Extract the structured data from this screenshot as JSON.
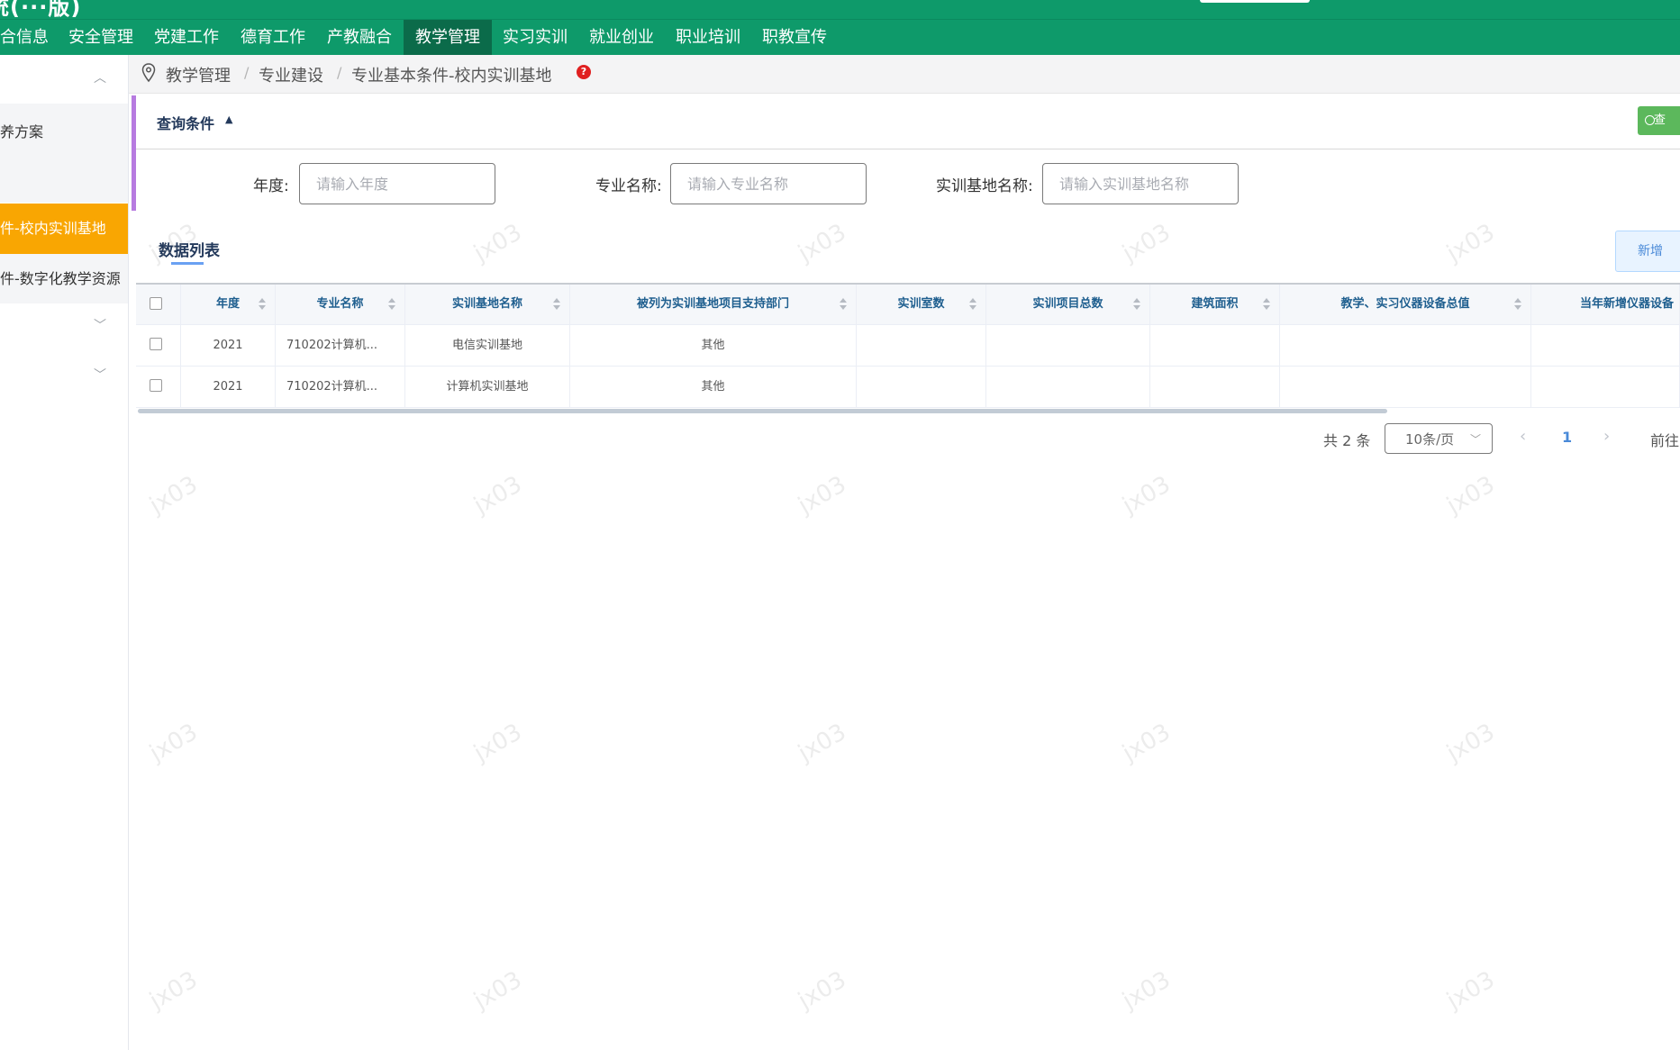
{
  "header": {
    "title_fragment": "统(···版)"
  },
  "nav": {
    "items": [
      "合信息",
      "安全管理",
      "党建工作",
      "德育工作",
      "产教融合",
      "教学管理",
      "实习实训",
      "就业创业",
      "职业培训",
      "职教宣传"
    ],
    "active_index": 5
  },
  "sidebar": {
    "items": [
      {
        "label": "养方案"
      },
      {
        "label": "件-校内实训基地"
      },
      {
        "label": "件-数字化教学资源"
      }
    ]
  },
  "breadcrumb": {
    "items": [
      "教学管理",
      "专业建设",
      "专业基本条件-校内实训基地"
    ],
    "separator": "/",
    "help": "?"
  },
  "query": {
    "title": "查询条件",
    "search_label": "查",
    "fields": [
      {
        "label": "年度:",
        "placeholder": "请输入年度"
      },
      {
        "label": "专业名称:",
        "placeholder": "请输入专业名称"
      },
      {
        "label": "实训基地名称:",
        "placeholder": "请输入实训基地名称"
      }
    ]
  },
  "list": {
    "title": "数据列表",
    "add_label": "新增",
    "columns": [
      "年度",
      "专业名称",
      "实训基地名称",
      "被列为实训基地项目支持部门",
      "实训室数",
      "实训项目总数",
      "建筑面积",
      "教学、实习仪器设备总值",
      "当年新增仪器设备"
    ],
    "rows": [
      [
        "2021",
        "710202计算机...",
        "电信实训基地",
        "其他",
        "",
        "",
        "",
        "",
        ""
      ],
      [
        "2021",
        "710202计算机...",
        "计算机实训基地",
        "其他",
        "",
        "",
        "",
        "",
        ""
      ]
    ]
  },
  "pagination": {
    "total": "共 2 条",
    "page_size": "10条/页",
    "current": "1",
    "goto": "前往"
  },
  "watermark": "jx03",
  "colors": {
    "nav_green": "#0e9a6a",
    "nav_active": "#0b6b4a",
    "sidebar_active": "#f9a602",
    "accent_purple": "#b77be0",
    "search_green": "#5cb85c",
    "link_blue": "#4a8ad8"
  }
}
